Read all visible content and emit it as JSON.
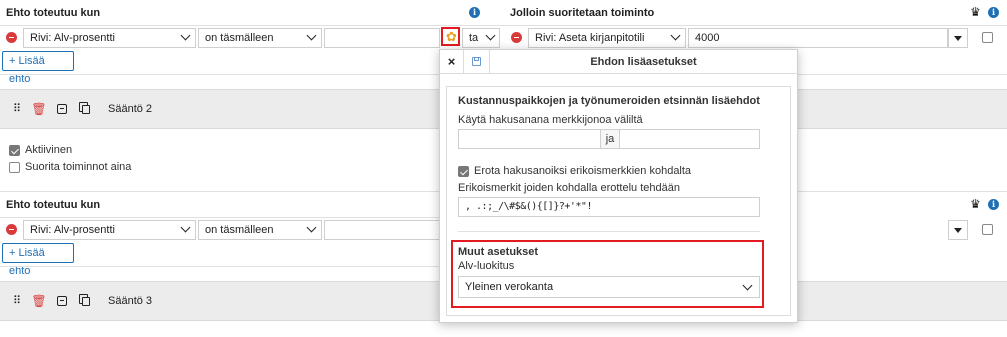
{
  "left_header": {
    "title": "Ehto toteutuu kun",
    "info_icon": "info-icon"
  },
  "right_header": {
    "title": "Jolloin suoritetaan toiminto",
    "crown_icon": "crown-icon",
    "info_icon": "info-icon"
  },
  "rule1": {
    "condition_field": "Rivi: Alv-prosentti",
    "operator": "on täsmälleen",
    "value": "",
    "gear_icon": "gear-icon",
    "action_prefix": "ta",
    "action_field": "Rivi: Aseta kirjanpitotili",
    "action_value": "4000",
    "add_condition": "+ Lisää ehto"
  },
  "rule2": {
    "name": "Sääntö 2",
    "active_label": "Aktiivinen",
    "always_label": "Suorita toiminnot aina",
    "header_title": "Ehto toteutuu kun",
    "condition_field": "Rivi: Alv-prosentti",
    "operator": "on täsmälleen",
    "add_condition": "+ Lisää ehto"
  },
  "rule3": {
    "name": "Sääntö 3"
  },
  "modal": {
    "title": "Ehdon lisäasetukset",
    "close_icon": "close-icon",
    "save_icon": "save-icon",
    "section1_title": "Kustannuspaikkojen ja työnumeroiden etsinnän lisäehdot",
    "range_label": "Käytä hakusanana merkkijonoa väliltä",
    "range_from": "",
    "range_sep": "ja",
    "range_to": "",
    "split_label": "Erota hakusanoiksi erikoismerkkien kohdalta",
    "split_checked": true,
    "special_chars_label": "Erikoismerkit joiden kohdalla erottelu tehdään",
    "special_chars_value": ", .:;_/\\#$&(){[]}?+'*\"!",
    "section2_title": "Muut asetukset",
    "vat_label": "Alv-luokitus",
    "vat_value": "Yleinen verokanta"
  },
  "colors": {
    "accent": "#1f6fb5",
    "danger": "#d93b3b",
    "highlight": "#e21a22",
    "band": "#ececec"
  }
}
